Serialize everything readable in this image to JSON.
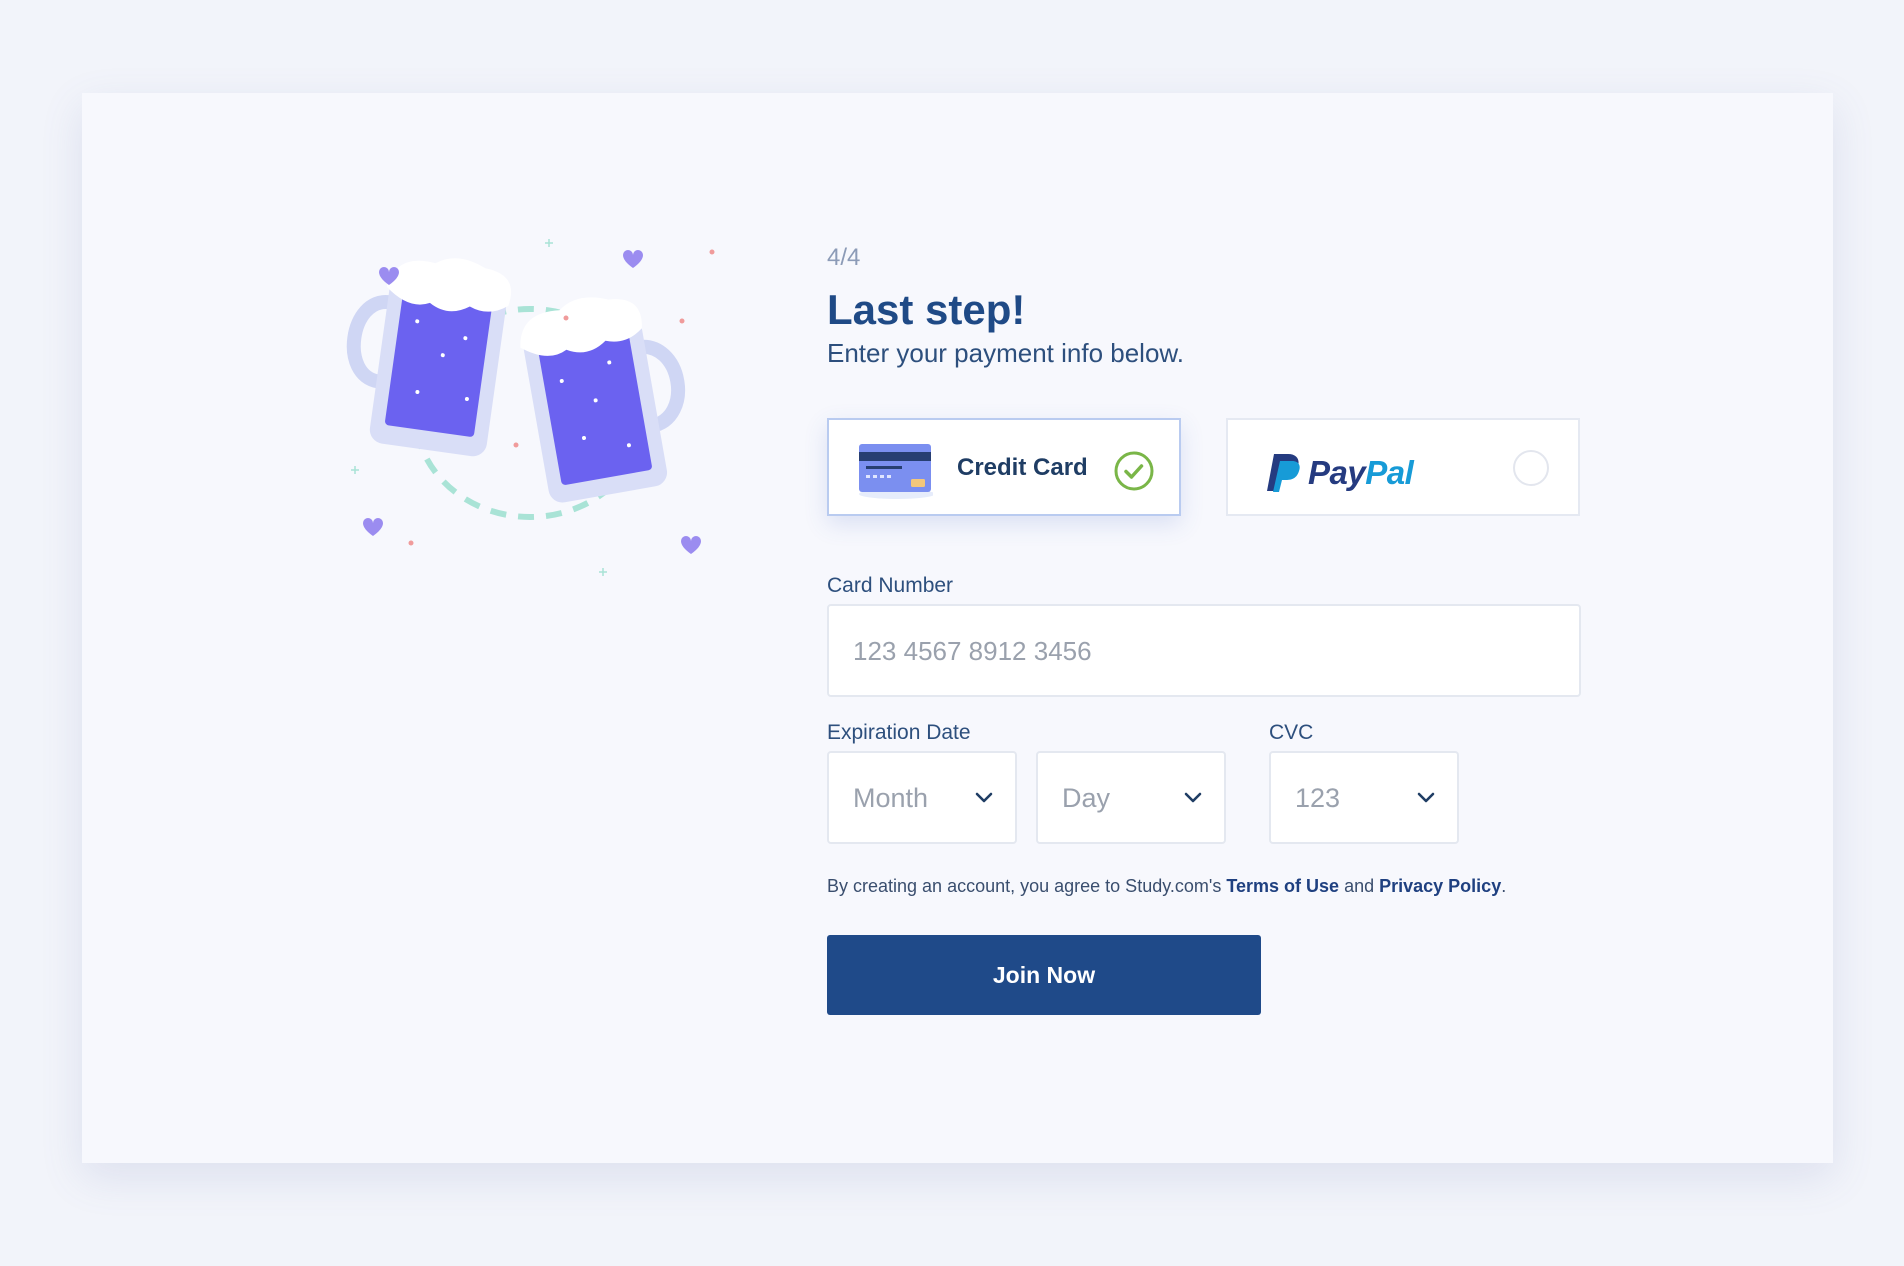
{
  "header": {
    "step": "4/4",
    "title": "Last step!",
    "subtitle": "Enter your payment info below."
  },
  "payment_methods": [
    {
      "label": "Credit Card",
      "selected": true,
      "icon": "credit-card-icon"
    },
    {
      "label": "PayPal",
      "logo_pay": "Pay",
      "logo_pal": "Pal",
      "selected": false,
      "icon": "paypal-logo"
    }
  ],
  "card_number": {
    "label": "Card Number",
    "placeholder": "123 4567 8912 3456"
  },
  "expiration": {
    "label": "Expiration Date",
    "month": "Month",
    "day": "Day"
  },
  "cvc": {
    "label": "CVC",
    "placeholder": "123"
  },
  "terms": {
    "prefix": "By creating an account, you agree to Study.com's",
    "terms_link": "Terms of Use",
    "and": "and",
    "privacy_link": "Privacy Policy",
    "suffix": "."
  },
  "join_button": "Join Now",
  "illustration": {
    "icon": "beer-mugs-cheers-illustration"
  },
  "colors": {
    "primary": "#1f4a89",
    "title": "#1f4a86",
    "selected_border": "#b9cbf0",
    "check_green": "#7ab648",
    "beer_purple": "#6b62f0",
    "paypal_dark": "#253b80",
    "paypal_light": "#179bd7"
  }
}
